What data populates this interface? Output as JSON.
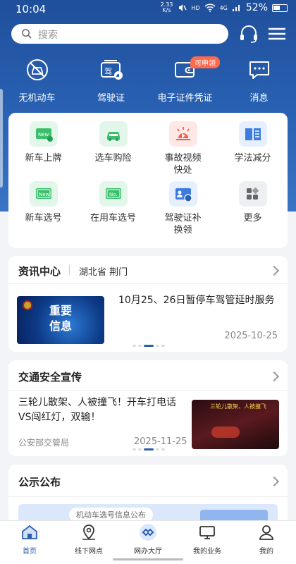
{
  "status": {
    "time": "10:04",
    "speed_value": "2.33",
    "speed_unit": "K/s",
    "hd": "HD",
    "net": "4G",
    "battery": "52%"
  },
  "search": {
    "placeholder": "搜索"
  },
  "quick_actions": [
    {
      "label": "无机动车",
      "icon": "car-icon"
    },
    {
      "label": "驾驶证",
      "icon": "license-icon"
    },
    {
      "label": "电子证件凭证",
      "icon": "wallet-icon",
      "badge": "可申领"
    },
    {
      "label": "消息",
      "icon": "message-icon"
    }
  ],
  "services": [
    {
      "label": "新车上牌",
      "icon": "new-plate-icon"
    },
    {
      "label": "选车购险",
      "icon": "car-insurance-icon"
    },
    {
      "label": "事故视频快处",
      "icon": "accident-video-icon"
    },
    {
      "label": "学法减分",
      "icon": "study-book-icon"
    },
    {
      "label": "新车选号",
      "icon": "new-number-icon"
    },
    {
      "label": "在用车选号",
      "icon": "used-number-icon"
    },
    {
      "label": "驾驶证补换领",
      "icon": "license-replace-icon"
    },
    {
      "label": "更多",
      "icon": "more-grid-icon"
    }
  ],
  "news": {
    "title": "资讯中心",
    "location": "湖北省 荆门",
    "thumb_text_1": "重要",
    "thumb_text_2": "信息",
    "headline": "10月25、26日暂停车驾管延时服务",
    "date": "2025-10-25"
  },
  "safety": {
    "title": "交通安全宣传",
    "headline": "三轮儿散架、人被撞飞！开车打电话VS闯红灯，双输！",
    "source": "公安部交管局",
    "date": "2025-11-25",
    "thumb_caption": "三轮儿散架、人被撞飞"
  },
  "notice": {
    "title": "公示公布",
    "banner_pill": "机动车选号信息公布"
  },
  "tabs": [
    {
      "label": "首页",
      "icon": "home-icon",
      "active": true
    },
    {
      "label": "线下网点",
      "icon": "location-icon",
      "active": false
    },
    {
      "label": "网办大厅",
      "icon": "hall-icon",
      "active": false
    },
    {
      "label": "我的业务",
      "icon": "monitor-icon",
      "active": false
    },
    {
      "label": "我的",
      "icon": "user-icon",
      "active": false
    }
  ],
  "colors": {
    "primary": "#2a5fae",
    "hero": "#1f4f9b",
    "badge": "#ff6a4d"
  }
}
